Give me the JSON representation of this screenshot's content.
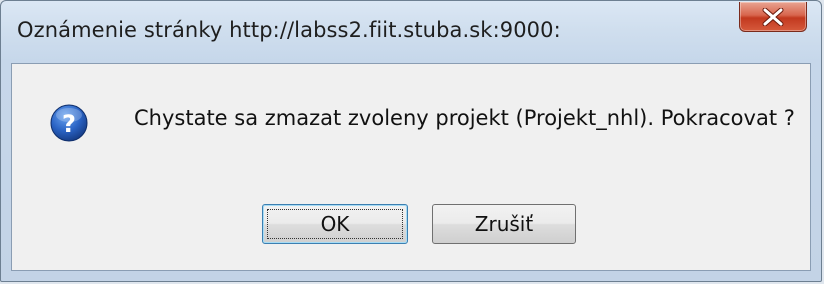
{
  "dialog": {
    "title": "Oznámenie stránky http://labss2.fiit.stuba.sk:9000:",
    "message": "Chystate sa zmazat zvoleny projekt (Projekt_nhl). Pokracovat ?",
    "icon": "question-icon",
    "close_icon": "close-icon",
    "buttons": {
      "ok_label": "OK",
      "cancel_label": "Zrušiť"
    }
  },
  "colors": {
    "close_button": "#c2391f",
    "icon_blue": "#1d4fa3",
    "content_bg": "#f0f0f0"
  }
}
